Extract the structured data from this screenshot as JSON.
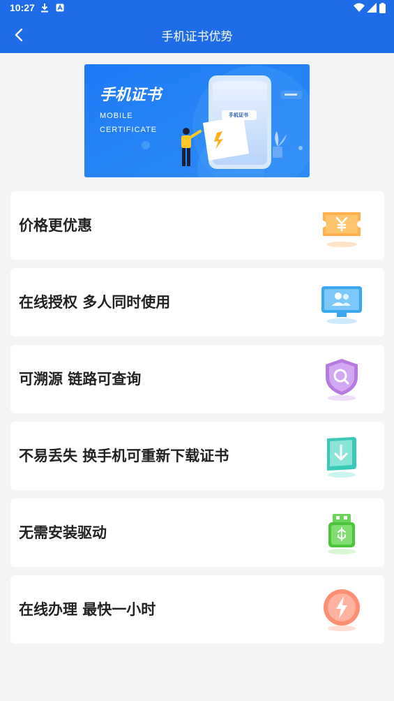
{
  "status_bar": {
    "time": "10:27"
  },
  "header": {
    "title": "手机证书优势"
  },
  "banner": {
    "title": "手机证书",
    "subtitle_line1": "MOBILE",
    "subtitle_line2": "CERTIFICATE",
    "card_text": "手机证书"
  },
  "advantages": [
    {
      "label": "价格更优惠",
      "icon": "yuan-ticket-icon"
    },
    {
      "label": "在线授权 多人同时使用",
      "icon": "monitor-users-icon"
    },
    {
      "label": "可溯源 链路可查询",
      "icon": "shield-search-icon"
    },
    {
      "label": "不易丢失 换手机可重新下载证书",
      "icon": "download-icon"
    },
    {
      "label": "无需安装驱动",
      "icon": "usb-icon"
    },
    {
      "label": "在线办理 最快一小时",
      "icon": "lightning-icon"
    }
  ],
  "colors": {
    "primary": "#1e6ce8",
    "background": "#f4f4f4",
    "card": "#ffffff",
    "text": "#222222"
  }
}
